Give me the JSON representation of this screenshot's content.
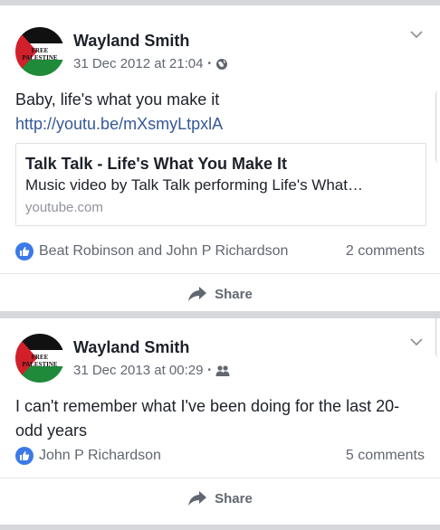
{
  "posts": [
    {
      "author": "Wayland Smith",
      "avatar_text": "FREE PALESTINE",
      "timestamp": "31 Dec 2012 at 21:04",
      "separator": "•",
      "privacy_icon": "globe-icon",
      "text": "Baby, life's what you make it",
      "link_text": "http://youtu.be/mXsmyLtpxlA",
      "link_preview": {
        "title": "Talk Talk - Life's What You Make It",
        "description": "Music video by Talk Talk performing Life's What…",
        "domain": "youtube.com"
      },
      "likers": "Beat Robinson and John P Richardson",
      "comments": "2 comments",
      "share_label": "Share"
    },
    {
      "author": "Wayland Smith",
      "avatar_text": "FREE PALESTINE",
      "timestamp": "31 Dec 2013 at 00:29",
      "separator": "•",
      "privacy_icon": "friends-icon",
      "text": "I can't remember what I've been doing for the last 20-odd years",
      "likers": "John P Richardson",
      "comments": "5 comments",
      "share_label": "Share"
    }
  ],
  "colors": {
    "like_blue": "#3b7ae6",
    "link": "#365899",
    "meta": "#616770",
    "background": "#d6d8dc"
  }
}
